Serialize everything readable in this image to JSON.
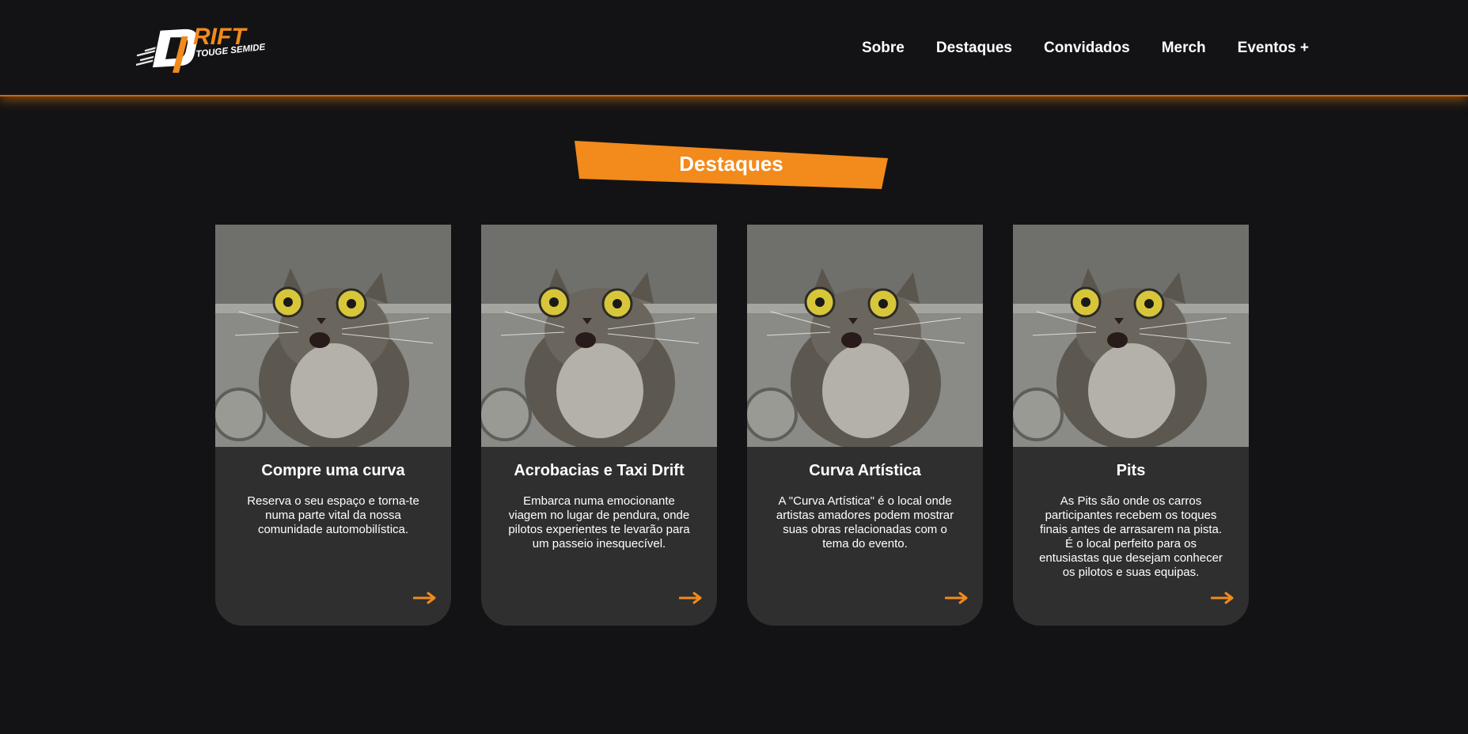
{
  "header": {
    "logo": {
      "word": "DRIFT",
      "tagline": "TOUGE SEMIDE"
    },
    "nav": [
      "Sobre",
      "Destaques",
      "Convidados",
      "Merch",
      "Eventos +"
    ]
  },
  "section": {
    "title": "Destaques"
  },
  "cards": [
    {
      "title": "Compre uma curva",
      "text": "Reserva o seu espaço e torna-te numa parte vital da nossa comunidade automobilística.",
      "arrow_icon": "arrow-right-icon"
    },
    {
      "title": "Acrobacias e Taxi Drift",
      "text": "Embarca numa emocionante viagem no lugar de pendura, onde pilotos experientes te levarão para um passeio inesquecível.",
      "arrow_icon": "arrow-right-icon"
    },
    {
      "title": "Curva Artística",
      "text": "A \"Curva Artística\" é o local onde artistas amadores podem mostrar suas obras relacionadas com o tema do evento.",
      "arrow_icon": "arrow-right-icon"
    },
    {
      "title": "Pits",
      "text": "As Pits são onde os carros participantes recebem os toques finais antes de arrasarem na pista. É o local perfeito para os entusiastas que desejam conhecer os pilotos e suas equipas.",
      "arrow_icon": "arrow-right-icon"
    }
  ],
  "colors": {
    "background": "#131315",
    "accent": "#f28a1c",
    "card": "#2f2f30",
    "text": "#ffffff"
  }
}
